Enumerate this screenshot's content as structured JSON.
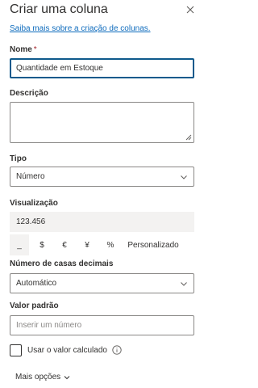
{
  "panel": {
    "title": "Criar uma coluna",
    "learn_more": "Saiba mais sobre a criação de colunas."
  },
  "name_field": {
    "label": "Nome",
    "required_mark": "*",
    "value": "Quantidade em Estoque"
  },
  "description_field": {
    "label": "Descrição",
    "value": ""
  },
  "type_field": {
    "label": "Tipo",
    "value": "Número"
  },
  "preview": {
    "label": "Visualização",
    "value": "123.456"
  },
  "format_options": [
    {
      "label": "_",
      "selected": true
    },
    {
      "label": "$",
      "selected": false
    },
    {
      "label": "€",
      "selected": false
    },
    {
      "label": "¥",
      "selected": false
    },
    {
      "label": "%",
      "selected": false
    },
    {
      "label": "Personalizado",
      "selected": false
    }
  ],
  "decimals_field": {
    "label": "Número de casas decimais",
    "value": "Automático"
  },
  "default_field": {
    "label": "Valor padrão",
    "placeholder": "Inserir um número"
  },
  "calculated_checkbox": {
    "label": "Usar o valor calculado",
    "checked": false
  },
  "more_options": {
    "label": "Mais opções"
  },
  "colors": {
    "link": "#0f6cbd",
    "focus_border": "#0f5a8c",
    "border": "#8a8886",
    "text": "#323130",
    "preview_bg": "#f3f2f1"
  },
  "icons": {
    "close": "close-icon",
    "dropdown": "chevron-down-icon",
    "info": "info-icon",
    "resize": "resize-grip-icon"
  }
}
